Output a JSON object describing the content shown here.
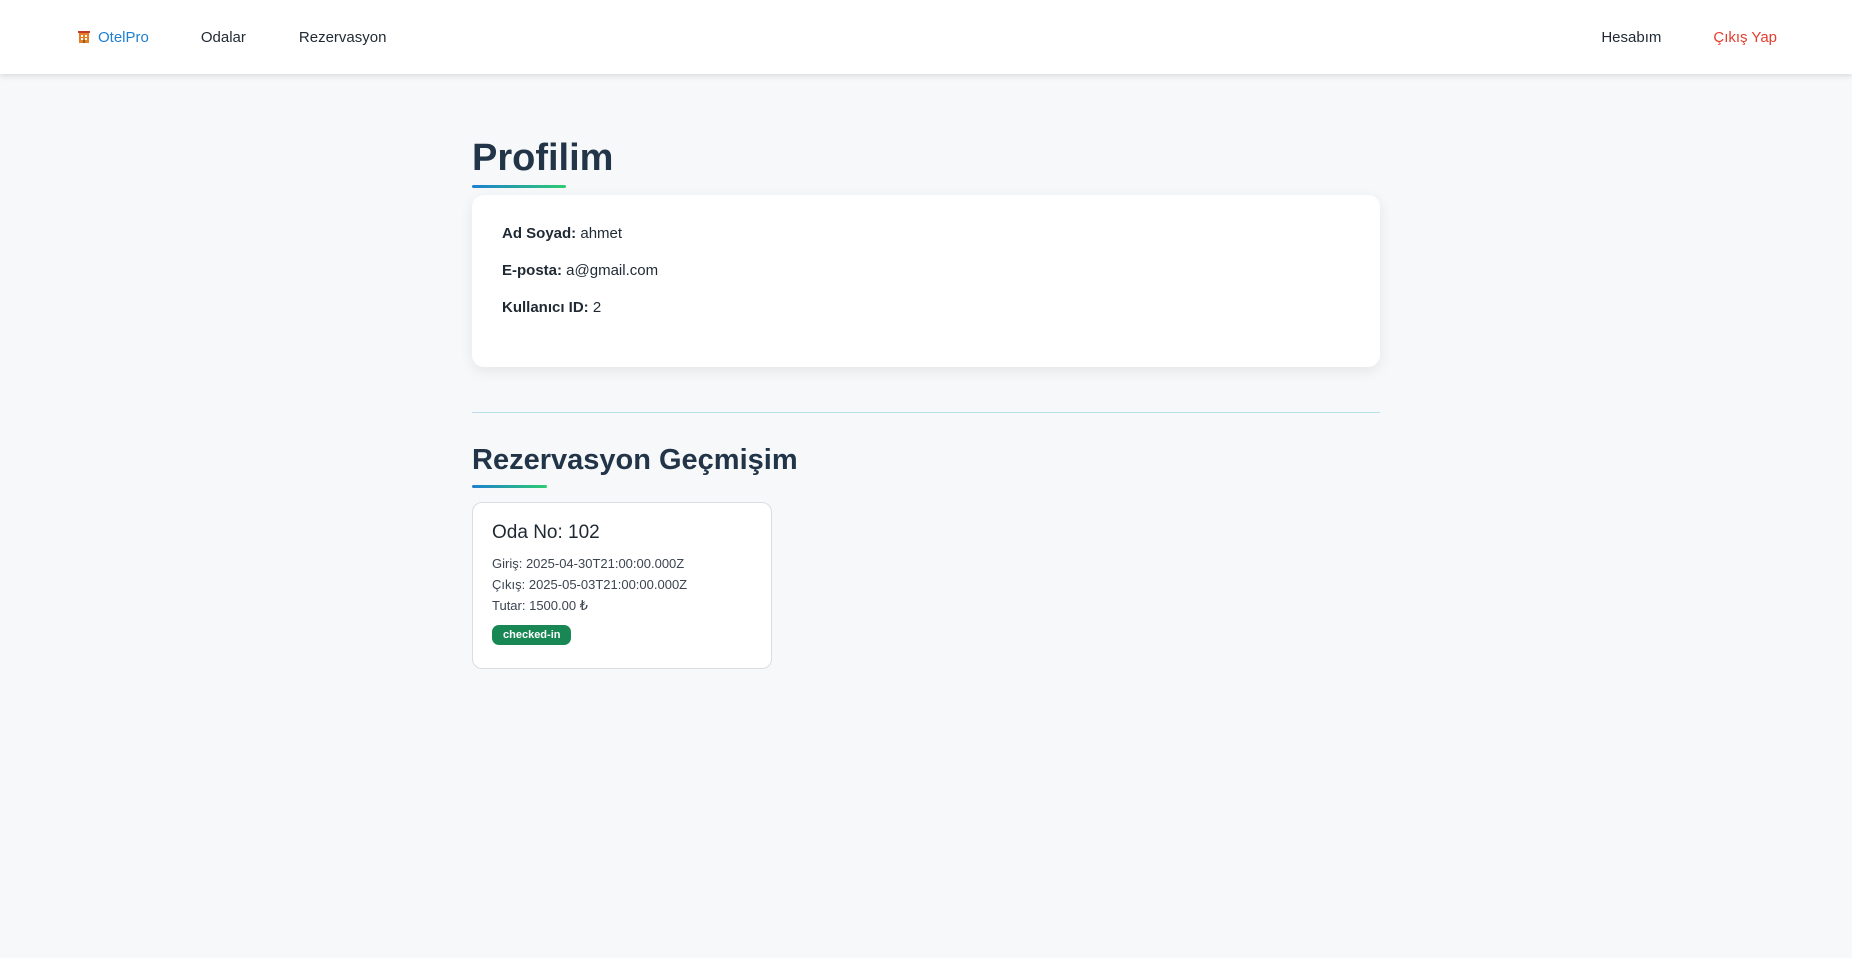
{
  "nav": {
    "brand": "OtelPro",
    "links": [
      "Odalar",
      "Rezervasyon"
    ],
    "account": "Hesabım",
    "logout": "Çıkış Yap"
  },
  "profile": {
    "title": "Profilim",
    "name_label": "Ad Soyad:",
    "name_value": "ahmet",
    "email_label": "E-posta:",
    "email_value": "a@gmail.com",
    "id_label": "Kullanıcı ID:",
    "id_value": "2"
  },
  "history": {
    "title": "Rezervasyon Geçmişim",
    "reservations": [
      {
        "room": "Oda No: 102",
        "checkin": "Giriş: 2025-04-30T21:00:00.000Z",
        "checkout": "Çıkış: 2025-05-03T21:00:00.000Z",
        "amount": "Tutar: 1500.00 ₺",
        "status": "checked-in"
      }
    ]
  },
  "colors": {
    "brand": "#1f7fd0",
    "logout": "#e23d2d",
    "status_checked_in": "#198754",
    "background": "#f6f8fa"
  },
  "icons": {
    "brand": "hotel-icon"
  }
}
